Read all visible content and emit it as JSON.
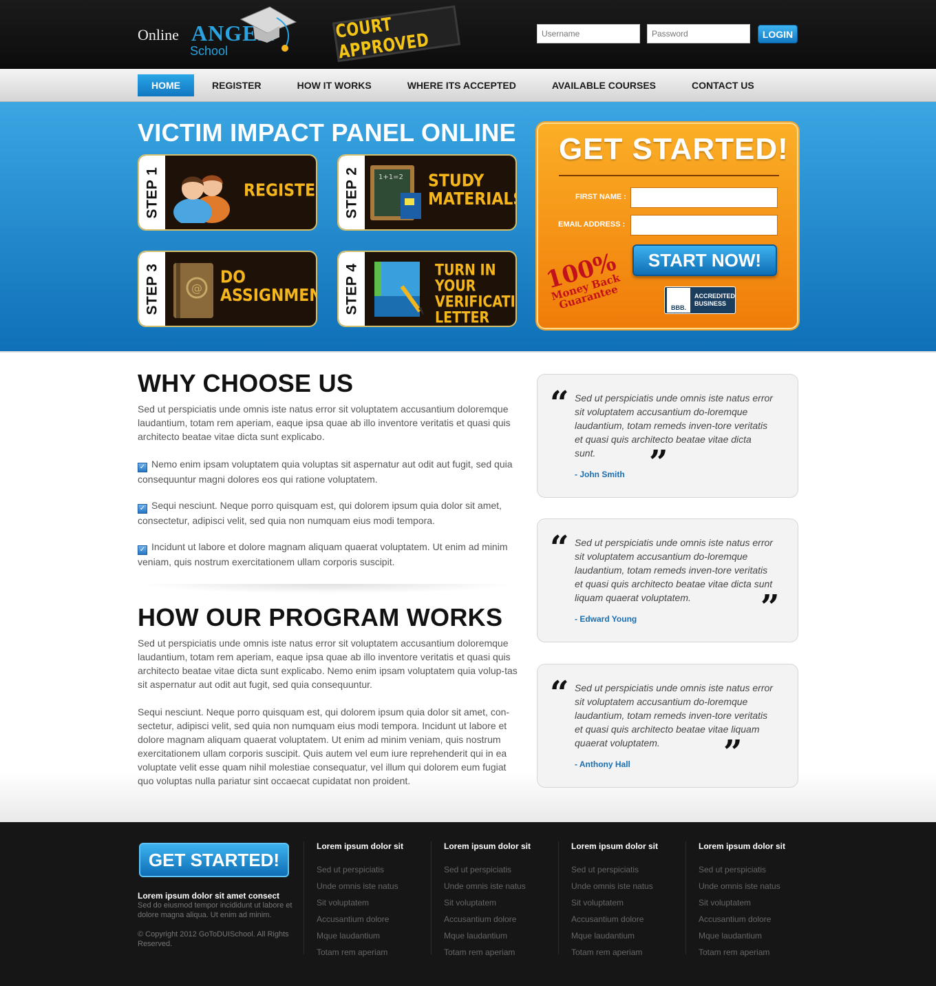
{
  "header": {
    "logo": {
      "online": "Online",
      "anger": "ANGER",
      "school": "School"
    },
    "stamp": "COURT APPROVED",
    "username_placeholder": "Username",
    "password_placeholder": "Password",
    "login_label": "LOGIN"
  },
  "nav": {
    "items": [
      {
        "label": "HOME",
        "active": true
      },
      {
        "label": "REGISTER",
        "active": false
      },
      {
        "label": "HOW IT WORKS",
        "active": false
      },
      {
        "label": "WHERE ITS ACCEPTED",
        "active": false
      },
      {
        "label": "AVAILABLE COURSES",
        "active": false
      },
      {
        "label": "CONTACT US",
        "active": false
      }
    ]
  },
  "hero": {
    "title": "VICTIM IMPACT PANEL ONLINE",
    "steps": [
      {
        "tab": "STEP 1",
        "label_lines": [
          "REGISTER"
        ],
        "icon": "people-icon"
      },
      {
        "tab": "STEP 2",
        "label_lines": [
          "STUDY",
          "MATERIALS"
        ],
        "icon": "chalkboard-icon"
      },
      {
        "tab": "STEP 3",
        "label_lines": [
          "DO",
          "ASSIGNMENTS"
        ],
        "icon": "address-book-icon"
      },
      {
        "tab": "STEP 4",
        "label_lines": [
          "TURN IN YOUR",
          "VERIFICATION",
          "LETTER"
        ],
        "icon": "notebook-pencil-icon"
      }
    ],
    "get_started": {
      "title": "GET STARTED!",
      "first_name_label": "FIRST NAME :",
      "email_label": "EMAIL ADDRESS :",
      "start_button": "START NOW!",
      "guarantee": [
        "100%",
        "Money Back",
        "Guarantee"
      ],
      "bbb": {
        "logo": "BBB.",
        "line1": "ACCREDITED",
        "line2": "BUSINESS"
      }
    }
  },
  "why": {
    "title": "WHY CHOOSE US",
    "intro": "Sed ut perspiciatis unde omnis iste natus error sit voluptatem accusantium doloremque laudantium, totam rem aperiam, eaque ipsa quae ab illo inventore veritatis et quasi quis architecto beatae vitae dicta sunt explicabo.",
    "points": [
      "Nemo enim ipsam voluptatem quia voluptas sit aspernatur aut odit aut fugit, sed quia consequuntur magni dolores eos qui ratione voluptatem.",
      "Sequi nesciunt. Neque porro quisquam est, qui dolorem ipsum quia dolor sit amet, consectetur, adipisci velit, sed quia non numquam eius modi tempora.",
      "Incidunt ut labore et dolore magnam aliquam quaerat voluptatem. Ut enim ad minim veniam, quis nostrum exercitationem ullam corporis suscipit."
    ]
  },
  "how": {
    "title": "HOW OUR PROGRAM WORKS",
    "para1": "Sed ut perspiciatis unde omnis iste natus error sit voluptatem accusantium doloremque laudantium, totam rem aperiam, eaque ipsa quae ab illo inventore veritatis et quasi quis architecto beatae vitae dicta sunt explicabo. Nemo enim ipsam voluptatem quia volup-tas sit aspernatur aut odit aut fugit, sed quia consequuntur.",
    "para2": "Sequi nesciunt. Neque porro quisquam est, qui dolorem ipsum quia dolor sit amet, con-sectetur, adipisci velit, sed quia non numquam eius modi tempora. Incidunt ut labore et dolore magnam aliquam quaerat voluptatem. Ut enim ad minim veniam, quis nostrum exercitationem ullam corporis suscipit. Quis autem vel eum iure reprehenderit qui in ea voluptate velit esse quam nihil molestiae consequatur, vel illum qui dolorem eum fugiat quo voluptas nulla pariatur sint occaecat cupidatat non proident."
  },
  "testimonials": [
    {
      "text": "Sed ut perspiciatis unde omnis iste natus error sit voluptatem accusantium do-loremque laudantium, totam remeds inven-tore veritatis et quasi quis architecto beatae vitae dicta sunt.",
      "author": "- John Smith"
    },
    {
      "text": "Sed ut perspiciatis unde omnis iste natus error sit voluptatem accusantium do-loremque laudantium, totam remeds inven-tore veritatis et quasi quis architecto beatae vitae dicta sunt liquam quaerat voluptatem.",
      "author": "- Edward Young"
    },
    {
      "text": "Sed ut perspiciatis unde omnis iste natus error sit voluptatem accusantium do-loremque laudantium, totam remeds inven-tore veritatis et quasi quis architecto beatae vitae liquam quaerat voluptatem.",
      "author": "- Anthony Hall"
    }
  ],
  "footer": {
    "button": "GET STARTED!",
    "about_title": "Lorem ipsum dolor sit amet consect",
    "about_text": "Sed do eiusmod tempor incididunt ut labore et dolore magna aliqua. Ut enim ad minim.",
    "copyright": "© Copyright 2012 GoToDUISchool. All Rights Reserved.",
    "columns": [
      {
        "title": "Lorem ipsum dolor sit",
        "links": [
          "Sed ut perspiciatis",
          "Unde omnis iste natus",
          "Sit voluptatem",
          "Accusantium dolore",
          "Mque laudantium",
          "Totam rem aperiam"
        ]
      },
      {
        "title": "Lorem ipsum dolor sit",
        "links": [
          "Sed ut perspiciatis",
          "Unde omnis iste natus",
          "Sit voluptatem",
          "Accusantium dolore",
          "Mque laudantium",
          "Totam rem aperiam"
        ]
      },
      {
        "title": "Lorem ipsum dolor sit",
        "links": [
          "Sed ut perspiciatis",
          "Unde omnis iste natus",
          "Sit voluptatem",
          "Accusantium dolore",
          "Mque laudantium",
          "Totam rem aperiam"
        ]
      },
      {
        "title": "Lorem ipsum dolor sit",
        "links": [
          "Sed ut perspiciatis",
          "Unde omnis iste natus",
          "Sit voluptatem",
          "Accusantium dolore",
          "Mque laudantium",
          "Totam rem aperiam"
        ]
      }
    ]
  },
  "colors": {
    "accent_blue": "#1a8fd6",
    "accent_orange": "#f79414",
    "step_gold": "#f4b61c",
    "dark": "#161616"
  }
}
